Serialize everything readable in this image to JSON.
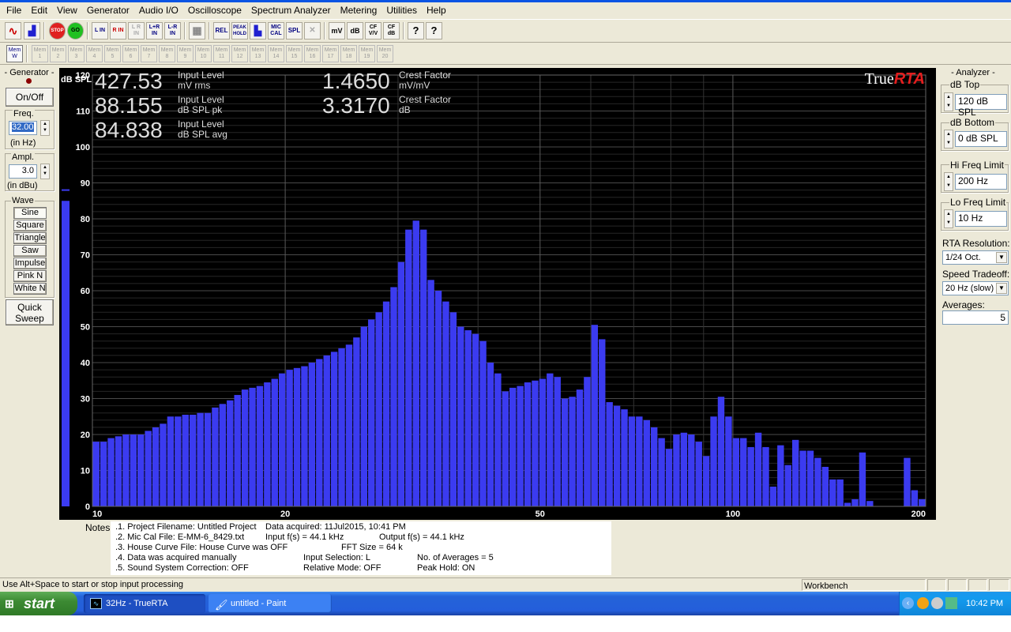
{
  "menu": [
    "File",
    "Edit",
    "View",
    "Generator",
    "Audio I/O",
    "Oscilloscope",
    "Spectrum Analyzer",
    "Metering",
    "Utilities",
    "Help"
  ],
  "toolbar": {
    "l_in": "L IN",
    "r_in": "R IN",
    "lr_in": "L R IN",
    "lplusr": "L+R IN",
    "lminusr": "L-R IN",
    "rel": "REL",
    "peak_hold": "PEAK HOLD",
    "mic_cal": "MIC CAL",
    "spl": "SPL",
    "mv": "mV",
    "db": "dB",
    "cf_vv": "CF V/V",
    "cf_db": "CF dB",
    "help": "?",
    "whats_this": "?"
  },
  "mem": {
    "labels": [
      "Mem W",
      "Mem 1",
      "Mem 2",
      "Mem 3",
      "Mem 4",
      "Mem 5",
      "Mem 6",
      "Mem 7",
      "Mem 8",
      "Mem 9",
      "Mem 10",
      "Mem 11",
      "Mem 12",
      "Mem 13",
      "Mem 14",
      "Mem 15",
      "Mem 16",
      "Mem 17",
      "Mem 18",
      "Mem 19",
      "Mem 20"
    ]
  },
  "generator": {
    "title": "- Generator -",
    "onoff": "On/Off",
    "freq_label": "Freq.",
    "freq_value": "32.00",
    "freq_unit": "(in Hz)",
    "ampl_label": "Ampl.",
    "ampl_value": "3.0",
    "ampl_unit": "(in dBu)",
    "wave_label": "Wave",
    "waves": [
      "Sine",
      "Square",
      "Triangle",
      "Saw",
      "Impulse",
      "Pink N",
      "White N"
    ],
    "quick_sweep": "Quick Sweep"
  },
  "readouts": [
    {
      "value": "427.53",
      "label1": "Input Level",
      "label2": "mV rms"
    },
    {
      "value": "88.155",
      "label1": "Input Level",
      "label2": "dB SPL pk"
    },
    {
      "value": "84.838",
      "label1": "Input Level",
      "label2": "dB SPL avg"
    },
    {
      "value": "1.4650",
      "label1": "Crest Factor",
      "label2": "mV/mV"
    },
    {
      "value": "3.3170",
      "label1": "Crest Factor",
      "label2": "dB"
    }
  ],
  "brand": {
    "prefix": "True",
    "suffix": "RTA"
  },
  "chart_data": {
    "type": "bar",
    "ylabel": "dB SPL",
    "ylim": [
      0,
      120
    ],
    "yticks": [
      0,
      10,
      20,
      30,
      40,
      50,
      60,
      70,
      80,
      90,
      100,
      110,
      120
    ],
    "x_scale": "log",
    "xlim": [
      10,
      200
    ],
    "xticks": [
      10,
      20,
      50,
      100,
      200
    ],
    "resolution": "1/24 Oct.",
    "bar_color": "#3b3bf0",
    "level_meter": 85,
    "level_meter_peak": 88,
    "values": [
      18,
      18,
      19,
      19.5,
      20,
      20,
      20,
      21,
      22,
      23,
      25,
      25,
      25.5,
      25.5,
      26,
      26,
      27.5,
      28.5,
      29.5,
      31,
      32.5,
      33,
      33.5,
      34.5,
      35.5,
      37,
      38,
      38.5,
      39,
      40,
      41,
      42,
      43,
      44,
      45,
      47,
      50,
      52,
      54,
      57,
      61,
      68,
      77,
      79.5,
      77,
      63,
      60,
      57,
      54,
      50,
      49,
      48,
      46,
      40,
      37,
      32,
      33,
      33.5,
      34.5,
      35,
      35.5,
      37,
      36,
      30,
      30.5,
      32.5,
      36,
      50.5,
      46.5,
      29,
      28,
      27,
      25,
      25,
      24,
      22,
      19,
      16,
      20,
      20.5,
      20,
      18,
      14,
      25,
      30.5,
      25,
      19,
      19,
      16.5,
      20.5,
      16.5,
      5.5,
      17,
      11.5,
      18.5,
      15.5,
      15.5,
      13.5,
      11,
      7.5,
      7.5,
      1,
      2,
      15,
      1.5,
      0,
      0,
      0,
      0,
      13.5,
      4.5,
      2
    ]
  },
  "analyzer": {
    "title": "- Analyzer -",
    "db_top_label": "dB Top",
    "db_top_value": "120 dB SPL",
    "db_bottom_label": "dB Bottom",
    "db_bottom_value": "0 dB SPL",
    "hi_freq_label": "Hi Freq Limit",
    "hi_freq_value": "200 Hz",
    "lo_freq_label": "Lo Freq Limit",
    "lo_freq_value": "10 Hz",
    "resolution_label": "RTA Resolution:",
    "resolution_value": "1/24 Oct.",
    "speed_label": "Speed Tradeoff:",
    "speed_value": "20 Hz (slow)",
    "averages_label": "Averages:",
    "averages_value": "5"
  },
  "notes": {
    "label": "Notes:",
    "lines": [
      {
        "a": ".1. Project Filename: Untitled Project",
        "b": "Data acquired: 11Jul2015, 10:41 PM",
        "c": ""
      },
      {
        "a": ".2. Mic Cal File: E-MM-6_8429.txt",
        "b": "Input f(s) = 44.1 kHz",
        "c": "Output f(s) = 44.1 kHz"
      },
      {
        "a": ".3. House Curve File: House Curve was OFF",
        "b": "FFT Size = 64 k",
        "c": ""
      },
      {
        "a": ".4. Data was acquired manually",
        "b": "Input Selection: L",
        "c": "No. of Averages = 5"
      },
      {
        "a": ".5. Sound System Correction: OFF",
        "b": "Relative Mode:  OFF",
        "c": "Peak Hold: ON"
      }
    ]
  },
  "status": {
    "hint": "Use Alt+Space to start or stop input processing",
    "mode": "Workbench"
  },
  "taskbar": {
    "start": "start",
    "tasks": [
      {
        "label": "32Hz - TrueRTA"
      },
      {
        "label": "untitled - Paint"
      }
    ],
    "clock": "10:42 PM"
  }
}
